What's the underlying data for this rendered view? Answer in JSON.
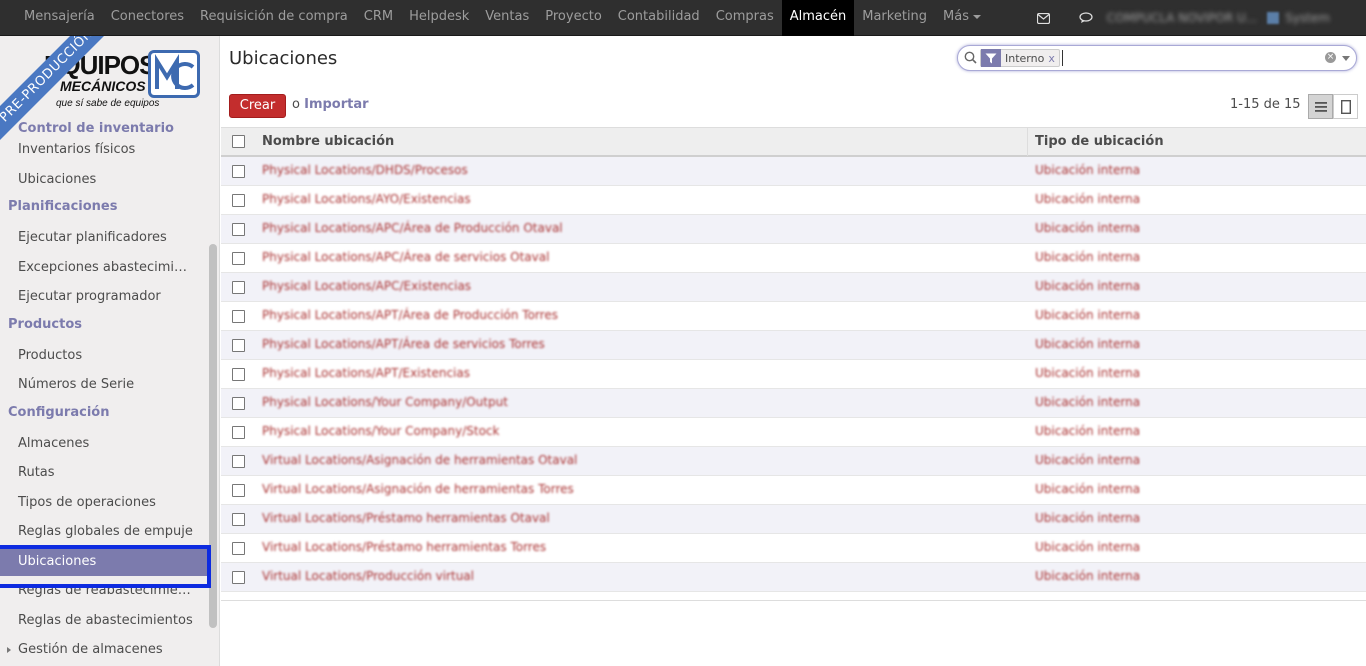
{
  "topbar": {
    "menu": [
      "Mensajería",
      "Conectores",
      "Requisición de compra",
      "CRM",
      "Helpdesk",
      "Ventas",
      "Proyecto",
      "Contabilidad",
      "Compras",
      "Almacén",
      "Marketing",
      "Más"
    ],
    "active": "Almacén",
    "user": "COMPUCLA NOVIPOR U...",
    "system": "System"
  },
  "sidebar": {
    "logo": {
      "ribbon": "PRE-PRODUCCIÓN",
      "line1": "EQUIPOS",
      "line2": "MECÁNICOS",
      "line3": "que sí sabe de equipos"
    },
    "sections": [
      {
        "title": "Control de inventario",
        "items": [
          "Inventarios físicos",
          "Ubicaciones"
        ]
      },
      {
        "title": "Planificaciones",
        "items": [
          "Ejecutar planificadores",
          "Excepciones abastecimi…",
          "Ejecutar programador"
        ]
      },
      {
        "title": "Productos",
        "items": [
          "Productos",
          "Números de Serie"
        ]
      },
      {
        "title": "Configuración",
        "items": [
          "Almacenes",
          "Rutas",
          "Tipos de operaciones",
          "Reglas globales de empuje",
          "Ubicaciones",
          "Reglas de reabastecimie…",
          "Reglas de abastecimientos",
          "Gestión de almacenes"
        ]
      }
    ],
    "active_item": "Ubicaciones"
  },
  "control_panel": {
    "title": "Ubicaciones",
    "search_facet": "Interno",
    "search_value": "",
    "create_label": "Crear",
    "or_label": "o",
    "import_label": "Importar",
    "pager": "1-15 de 15"
  },
  "table": {
    "headers": [
      "Nombre ubicación",
      "Tipo de ubicación"
    ],
    "rows": [
      {
        "name": "Physical Locations/DHDS/Procesos",
        "type": "Ubicación interna"
      },
      {
        "name": "Physical Locations/AYO/Existencias",
        "type": "Ubicación interna"
      },
      {
        "name": "Physical Locations/APC/Área de Producción Otaval",
        "type": "Ubicación interna"
      },
      {
        "name": "Physical Locations/APC/Área de servicios Otaval",
        "type": "Ubicación interna"
      },
      {
        "name": "Physical Locations/APC/Existencias",
        "type": "Ubicación interna"
      },
      {
        "name": "Physical Locations/APT/Área de Producción Torres",
        "type": "Ubicación interna"
      },
      {
        "name": "Physical Locations/APT/Área de servicios Torres",
        "type": "Ubicación interna"
      },
      {
        "name": "Physical Locations/APT/Existencias",
        "type": "Ubicación interna"
      },
      {
        "name": "Physical Locations/Your Company/Output",
        "type": "Ubicación interna"
      },
      {
        "name": "Physical Locations/Your Company/Stock",
        "type": "Ubicación interna"
      },
      {
        "name": "Virtual Locations/Asignación de herramientas Otaval",
        "type": "Ubicación interna"
      },
      {
        "name": "Virtual Locations/Asignación de herramientas Torres",
        "type": "Ubicación interna"
      },
      {
        "name": "Virtual Locations/Préstamo herramientas Otaval",
        "type": "Ubicación interna"
      },
      {
        "name": "Virtual Locations/Préstamo herramientas Torres",
        "type": "Ubicación interna"
      },
      {
        "name": "Virtual Locations/Producción virtual",
        "type": "Ubicación interna"
      }
    ]
  }
}
